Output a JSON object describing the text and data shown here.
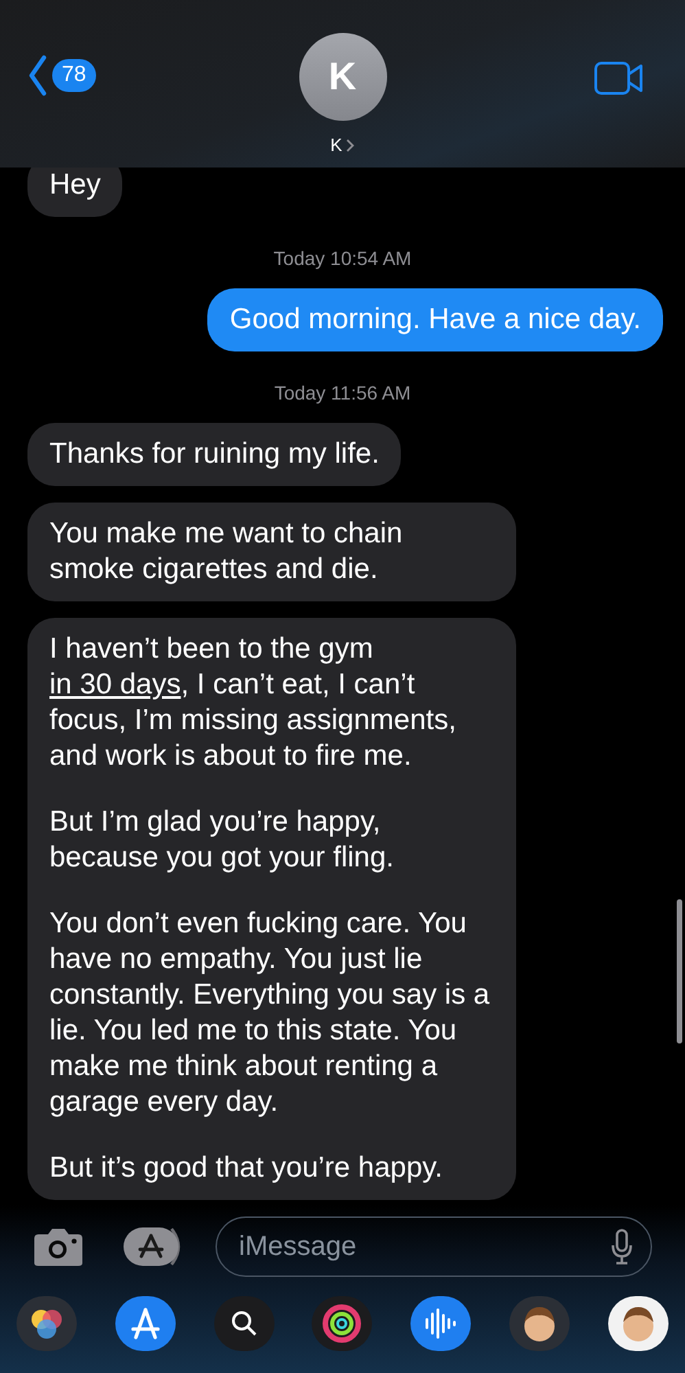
{
  "header": {
    "back_badge": "78",
    "avatar_initial": "K",
    "contact_name": "K"
  },
  "messages": [
    {
      "kind": "received",
      "paragraphs": [
        [
          {
            "kind": "text",
            "text": "Hey"
          }
        ]
      ]
    },
    {
      "kind": "timestamp",
      "text": "Today 10:54 AM"
    },
    {
      "kind": "sent",
      "paragraphs": [
        [
          {
            "kind": "text",
            "text": "Good morning. Have a nice day."
          }
        ]
      ]
    },
    {
      "kind": "timestamp",
      "text": "Today 11:56 AM"
    },
    {
      "kind": "received",
      "paragraphs": [
        [
          {
            "kind": "text",
            "text": "Thanks for ruining my life."
          }
        ]
      ]
    },
    {
      "kind": "received",
      "paragraphs": [
        [
          {
            "kind": "text",
            "text": "You make me want to chain smoke cigarettes and die."
          }
        ]
      ]
    },
    {
      "kind": "received",
      "paragraphs": [
        [
          {
            "kind": "text",
            "text": "I haven’t been to the gym "
          },
          {
            "kind": "link",
            "text": "in 30 days"
          },
          {
            "kind": "text",
            "text": ", I can’t eat, I can’t focus, I’m missing assignments, and work is about to fire me."
          }
        ],
        [
          {
            "kind": "text",
            "text": "But I’m glad you’re happy, because you got your fling."
          }
        ],
        [
          {
            "kind": "text",
            "text": "You don’t even fucking care. You have no empathy. You just lie constantly. Everything you say is a lie. You led me to this state. You make me think about renting a garage every day."
          }
        ],
        [
          {
            "kind": "text",
            "text": "But it’s good that you’re happy."
          }
        ]
      ]
    }
  ],
  "composer": {
    "placeholder": "iMessage"
  }
}
